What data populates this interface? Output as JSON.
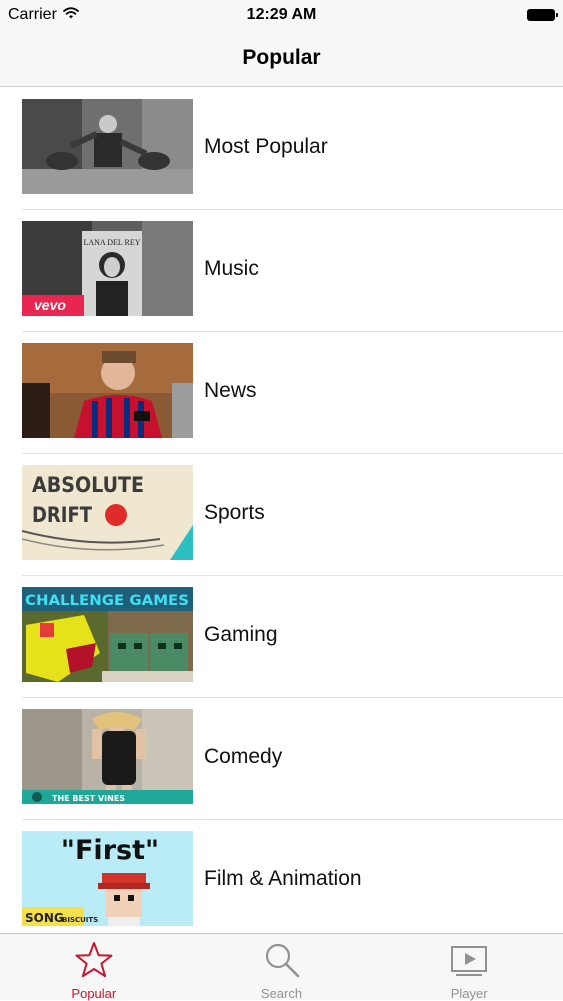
{
  "status_bar": {
    "carrier": "Carrier",
    "time": "12:29 AM"
  },
  "nav": {
    "title": "Popular"
  },
  "categories": [
    {
      "label": "Most Popular"
    },
    {
      "label": "Music",
      "thumb_text": "LANA DEL REY",
      "thumb_badge": "vevo"
    },
    {
      "label": "News"
    },
    {
      "label": "Sports",
      "thumb_text": "ABSOLUTE DRIFT"
    },
    {
      "label": "Gaming",
      "thumb_text": "CHALLENGE GAMES"
    },
    {
      "label": "Comedy",
      "thumb_text": "THE BEST VINES"
    },
    {
      "label": "Film & Animation",
      "thumb_text": "\"First\"",
      "thumb_badge": "SONG",
      "thumb_badge2": "BISCUITS"
    }
  ],
  "tabs": [
    {
      "label": "Popular",
      "icon": "star-icon",
      "active": true
    },
    {
      "label": "Search",
      "icon": "search-icon",
      "active": false
    },
    {
      "label": "Player",
      "icon": "play-icon",
      "active": false
    }
  ],
  "colors": {
    "accent": "#c5162c",
    "inactive_tab": "#929292"
  }
}
